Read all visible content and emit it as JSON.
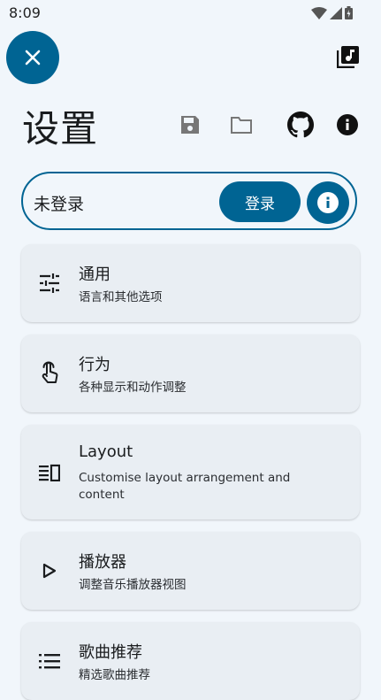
{
  "status_bar": {
    "time": "8:09"
  },
  "header": {
    "title": "设置"
  },
  "login": {
    "status": "未登录",
    "button_label": "登录"
  },
  "settings": [
    {
      "title": "通用",
      "subtitle": "语言和其他选项",
      "icon": "tune-icon"
    },
    {
      "title": "行为",
      "subtitle": "各种显示和动作调整",
      "icon": "touch-icon"
    },
    {
      "title": "Layout",
      "subtitle": "Customise layout arrangement and content",
      "icon": "layout-icon"
    },
    {
      "title": "播放器",
      "subtitle": "调整音乐播放器视图",
      "icon": "play-icon"
    },
    {
      "title": "歌曲推荐",
      "subtitle": "精选歌曲推荐",
      "icon": "list-icon"
    }
  ],
  "colors": {
    "accent": "#006493",
    "background": "#f1f6fb",
    "card": "#e9eef3"
  }
}
